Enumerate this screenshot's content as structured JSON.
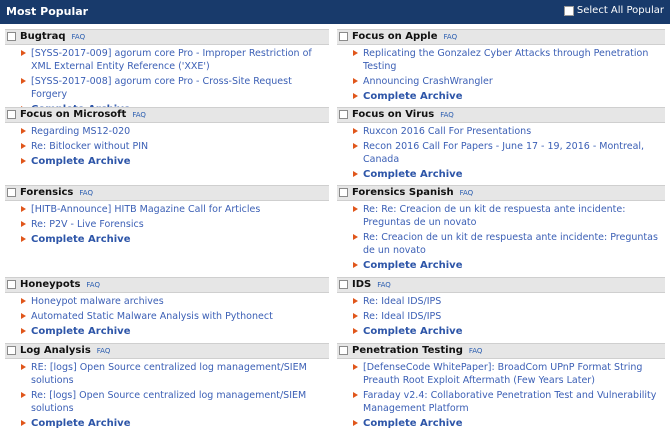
{
  "header": {
    "title": "Most Popular",
    "select_all": "Select All Popular"
  },
  "faq_label": "FAQ",
  "complete_label": "Complete Archive",
  "left": [
    {
      "name": "Bugtraq",
      "items": [
        "[SYSS-2017-009] agorum core Pro - Improper Restriction of XML External Entity Reference ('XXE')",
        "[SYSS-2017-008] agorum core Pro - Cross-Site Request Forgery"
      ]
    },
    {
      "name": "Focus on Microsoft",
      "items": [
        "Regarding MS12-020",
        "Re: Bitlocker without PIN"
      ]
    },
    {
      "name": "Forensics",
      "items": [
        "[HITB-Announce] HITB Magazine Call for Articles",
        "Re: P2V - Live Forensics"
      ]
    },
    {
      "name": "Honeypots",
      "items": [
        "Honeypot malware archives",
        "Automated Static Malware Analysis with Pythonect"
      ]
    },
    {
      "name": "Log Analysis",
      "items": [
        "RE: [logs] Open Source centralized log management/SIEM solutions",
        "Re: [logs] Open Source centralized log management/SIEM solutions"
      ]
    }
  ],
  "right": [
    {
      "name": "Focus on Apple",
      "items": [
        "Replicating the Gonzalez Cyber Attacks through Penetration Testing",
        "Announcing CrashWrangler"
      ]
    },
    {
      "name": "Focus on Virus",
      "items": [
        "Ruxcon 2016 Call For Presentations",
        "Recon 2016 Call For Papers - June 17 - 19, 2016 - Montreal, Canada"
      ]
    },
    {
      "name": "Forensics Spanish",
      "items": [
        "Re: Re: Creacion de un kit de respuesta ante incidente: Preguntas de un novato",
        "Re: Creacion de un kit de respuesta ante incidente: Preguntas de un novato"
      ]
    },
    {
      "name": "IDS",
      "items": [
        "Re: Ideal IDS/IPS",
        "Re: Ideal IDS/IPS"
      ]
    },
    {
      "name": "Penetration Testing",
      "items": [
        "[DefenseCode WhitePaper]: BroadCom UPnP Format String Preauth Root Exploit Aftermath (Few Years Later)",
        "Faraday v2.4: Collaborative Penetration Test and Vulnerability Management Platform"
      ]
    }
  ]
}
